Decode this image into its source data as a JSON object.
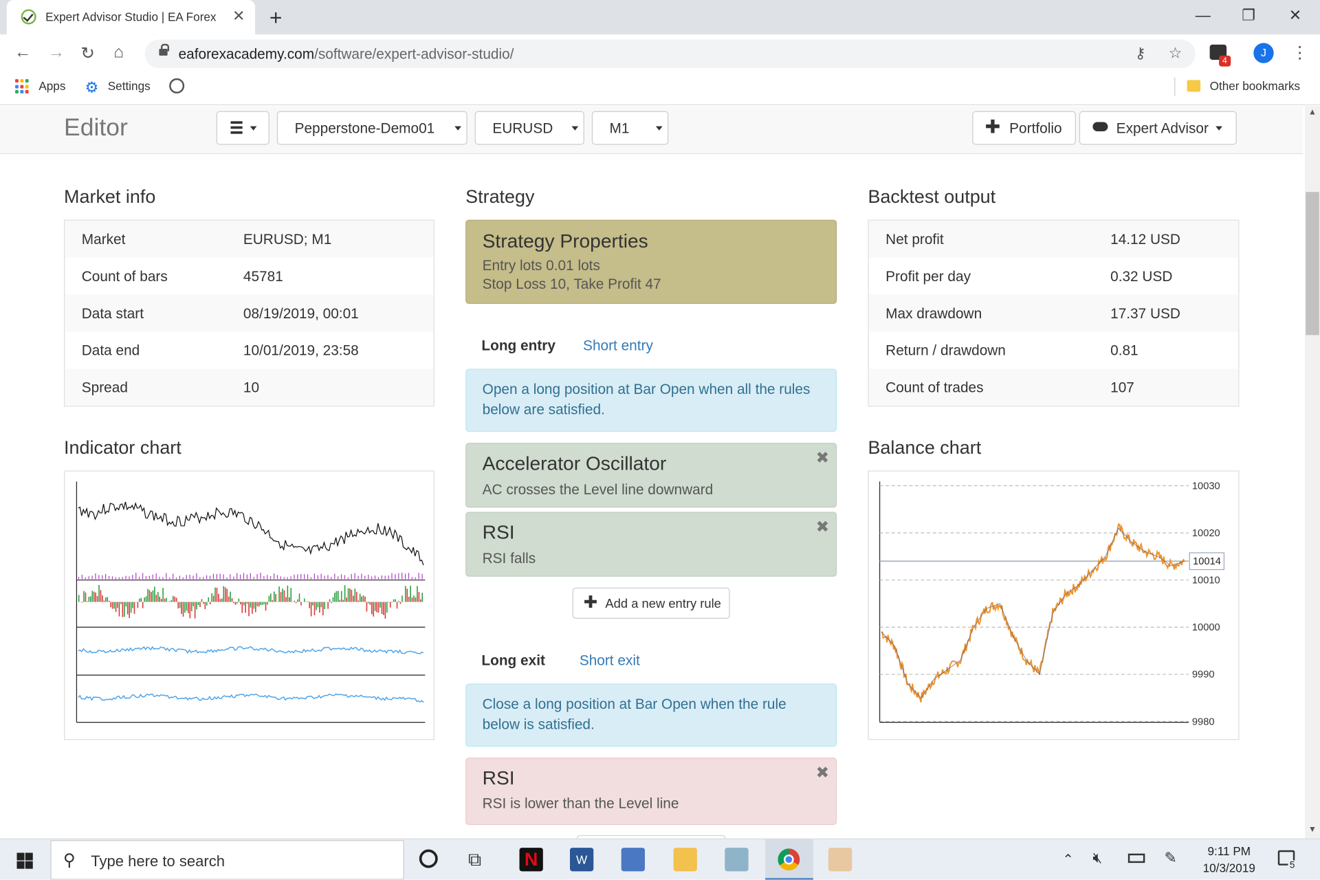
{
  "browser": {
    "tab_title": "Expert Advisor Studio | EA Forex",
    "url_domain": "eaforexacademy.com",
    "url_path": "/software/expert-advisor-studio/",
    "profile_initial": "J",
    "extension_badge": "4",
    "bookmarks": {
      "apps": "Apps",
      "settings": "Settings",
      "other": "Other bookmarks"
    }
  },
  "editor": {
    "title": "Editor",
    "account": "Pepperstone-Demo01",
    "symbol": "EURUSD",
    "timeframe": "M1",
    "portfolio_label": "Portfolio",
    "expert_advisor_label": "Expert Advisor"
  },
  "market_info": {
    "heading": "Market info",
    "rows": [
      {
        "key": "Market",
        "value": "EURUSD; M1"
      },
      {
        "key": "Count of bars",
        "value": "45781"
      },
      {
        "key": "Data start",
        "value": "08/19/2019, 00:01"
      },
      {
        "key": "Data end",
        "value": "10/01/2019, 23:58"
      },
      {
        "key": "Spread",
        "value": "10"
      }
    ]
  },
  "strategy": {
    "heading": "Strategy",
    "properties": {
      "title": "Strategy Properties",
      "line1": "Entry lots 0.01 lots",
      "line2": "Stop Loss 10, Take Profit 47"
    },
    "entry_tabs": {
      "active": "Long entry",
      "inactive": "Short entry"
    },
    "entry_info": "Open a long position at Bar Open when all the rules below are satisfied.",
    "entry_rules": [
      {
        "title": "Accelerator Oscillator",
        "desc": "AC crosses the Level line downward"
      },
      {
        "title": "RSI",
        "desc": "RSI falls"
      }
    ],
    "add_rule_label": "Add a new entry rule",
    "exit_tabs": {
      "active": "Long exit",
      "inactive": "Short exit"
    },
    "exit_info": "Close a long position at Bar Open when the rule below is satisfied.",
    "exit_rules": [
      {
        "title": "RSI",
        "desc": "RSI is lower than the Level line"
      }
    ]
  },
  "backtest": {
    "heading": "Backtest output",
    "rows": [
      {
        "key": "Net profit",
        "value": "14.12 USD"
      },
      {
        "key": "Profit per day",
        "value": "0.32 USD"
      },
      {
        "key": "Max drawdown",
        "value": "17.37 USD"
      },
      {
        "key": "Return / drawdown",
        "value": "0.81"
      },
      {
        "key": "Count of trades",
        "value": "107"
      }
    ]
  },
  "indicator_chart": {
    "heading": "Indicator chart"
  },
  "balance_chart": {
    "heading": "Balance chart",
    "y_ticks": [
      "10030",
      "10020",
      "10010",
      "10000",
      "9990",
      "9980"
    ],
    "current_label": "10014"
  },
  "chart_data": [
    {
      "type": "line",
      "title": "Balance chart",
      "ylim": [
        9980,
        10030
      ],
      "y_ticks": [
        9980,
        9990,
        10000,
        10010,
        10020,
        10030
      ],
      "current_value": 10014,
      "series": [
        {
          "values": [
            9999,
            9996,
            9988,
            9985,
            9989,
            9991,
            9993,
            10000,
            10004,
            10005,
            9998,
            9993,
            9990,
            10003,
            10007,
            10009,
            10012,
            10015,
            10021,
            10018,
            10016,
            10015,
            10013,
            10014
          ]
        }
      ]
    }
  ],
  "taskbar": {
    "search_placeholder": "Type here to search",
    "time": "9:11 PM",
    "date": "10/3/2019",
    "notification_count": "5"
  }
}
